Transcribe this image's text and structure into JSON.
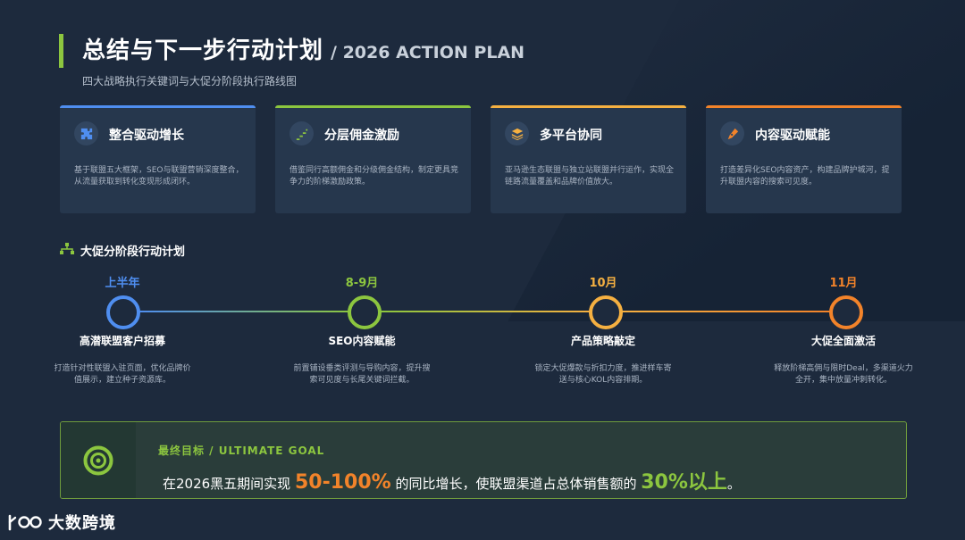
{
  "header": {
    "title": "总结与下一步行动计划",
    "title_en": "/ 2026 ACTION PLAN",
    "subtitle": "四大战略执行关键词与大促分阶段执行路线图"
  },
  "cards": [
    {
      "title": "整合驱动增长",
      "desc": "基于联盟五大框架，SEO与联盟营销深度整合，从流量获取到转化变现形成闭环。",
      "icon": "puzzle-icon",
      "accent": "#4f8ef0"
    },
    {
      "title": "分层佣金激励",
      "desc": "借鉴同行高额佣金和分级佣金结构，制定更具竞争力的阶梯激励政策。",
      "icon": "stairs-icon",
      "accent": "#8cc63f"
    },
    {
      "title": "多平台协同",
      "desc": "亚马逊生态联盟与独立站联盟并行运作，实现全链路流量覆盖和品牌价值放大。",
      "icon": "layers-icon",
      "accent": "#f5b041"
    },
    {
      "title": "内容驱动赋能",
      "desc": "打造差异化SEO内容资产，构建品牌护城河，提升联盟内容的搜索可见度。",
      "icon": "pen-icon",
      "accent": "#f2832a"
    }
  ],
  "section": {
    "title": "大促分阶段行动计划",
    "icon": "sitemap-icon"
  },
  "timeline": [
    {
      "period": "上半年",
      "name": "高潜联盟客户招募",
      "desc": "打造针对性联盟入驻页面，优化品牌价值展示，建立种子资源库。",
      "color": "#4f8ef0"
    },
    {
      "period": "8-9月",
      "name": "SEO内容赋能",
      "desc": "前置铺设垂类评测与导购内容，提升搜索可见度与长尾关键词拦截。",
      "color": "#8cc63f"
    },
    {
      "period": "10月",
      "name": "产品策略敲定",
      "desc": "锁定大促爆款与折扣力度，推进样车寄送与核心KOL内容排期。",
      "color": "#f5b041"
    },
    {
      "period": "11月",
      "name": "大促全面激活",
      "desc": "释放阶梯高佣与限时Deal，多渠道火力全开，集中放量冲刺转化。",
      "color": "#f2832a"
    }
  ],
  "goal": {
    "label": "最终目标 / ULTIMATE GOAL",
    "text_1": "在2026黑五期间实现 ",
    "highlight_1": "50-100%",
    "text_2": " 的同比增长，使联盟渠道占总体销售额的 ",
    "highlight_2": "30%以上",
    "text_3": "。",
    "icon": "target-icon"
  },
  "logo": {
    "text": "大数跨境",
    "mark": "100"
  },
  "colors": {
    "background": "#1d2a3d",
    "card": "#26374d",
    "green": "#8cc63f",
    "blue": "#4f8ef0",
    "yellow": "#f5b041",
    "orange": "#f2832a"
  }
}
